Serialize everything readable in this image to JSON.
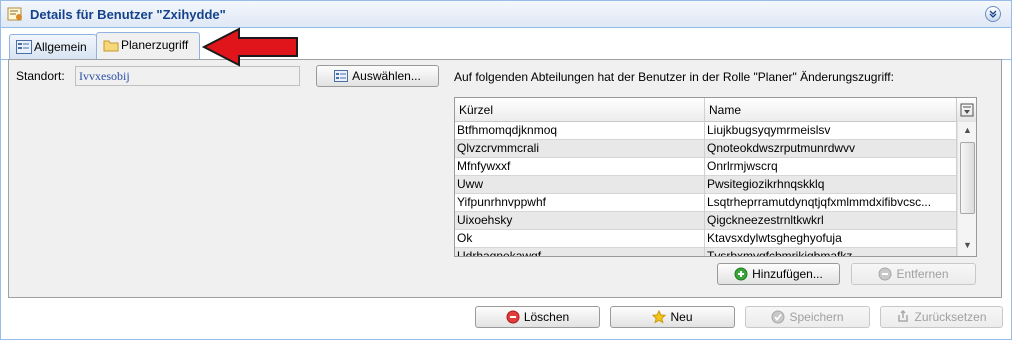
{
  "window": {
    "title": "Details für Benutzer \"Zxihydde\"",
    "icons": {
      "title": "user-details-icon",
      "collapse": "double-chevron-down-icon"
    }
  },
  "tabs": [
    {
      "label": "Allgemein",
      "icon": "form-icon",
      "active": false
    },
    {
      "label": "Planerzugriff",
      "icon": "folder-icon",
      "active": true
    }
  ],
  "standort": {
    "label": "Standort:",
    "value": "Ivvxesobij",
    "select_button": "Auswählen..."
  },
  "abteilungen": {
    "label": "Auf folgenden Abteilungen hat der Benutzer in der Rolle \"Planer\" Änderungszugriff:",
    "columns": [
      "Kürzel",
      "Name"
    ],
    "rows": [
      {
        "kuerzel": "Btfhmomqdjknmoq",
        "name": "Liujkbugsyqymrmeislsv"
      },
      {
        "kuerzel": "Qlvzcrvmmcrali",
        "name": "Qnoteokdwszrputmunrdwvv"
      },
      {
        "kuerzel": "Mfnfywxxf",
        "name": "Onrlrmjwscrq"
      },
      {
        "kuerzel": "Uww",
        "name": "Pwsitegiozikrhnqskklq"
      },
      {
        "kuerzel": "Yifpunrhnvppwhf",
        "name": "Lsqtrheprramutdynqtjqfxmlmmdxifibvcsc..."
      },
      {
        "kuerzel": "Uixoehsky",
        "name": "Qigckneezestrnltkwkrl"
      },
      {
        "kuerzel": "Ok",
        "name": "Ktavsxdylwtsgheghyofuja"
      },
      {
        "kuerzel": "Udrhaqnekawqf",
        "name": "Tvsrbxmygfcbmrikjgbmafkz"
      }
    ],
    "add_button": "Hinzufügen...",
    "remove_button": "Entfernen"
  },
  "footer": {
    "delete": "Löschen",
    "new": "Neu",
    "save": "Speichern",
    "reset": "Zurücksetzen"
  },
  "colors": {
    "accent": "#15428b",
    "pointer_arrow": "#e0151b"
  }
}
